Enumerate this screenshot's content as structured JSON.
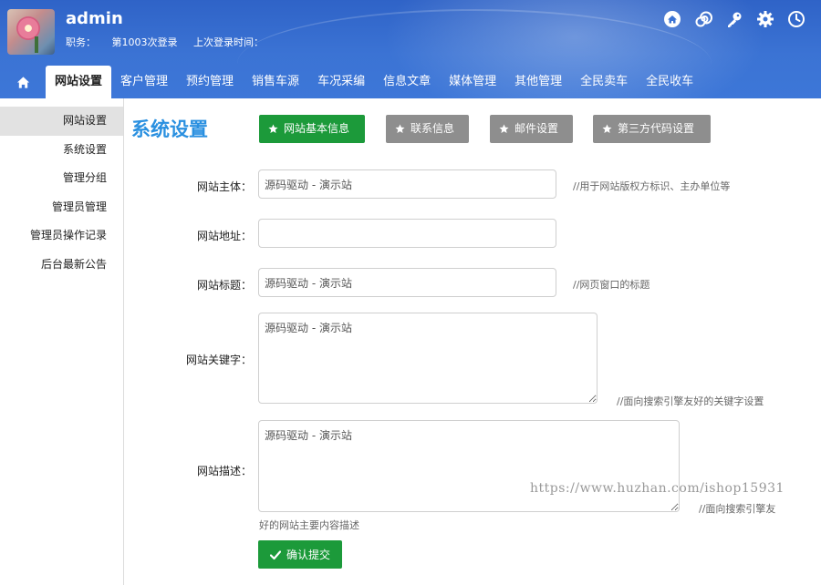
{
  "user": {
    "name": "admin",
    "role_label": "职务：",
    "login_count": "第1003次登录",
    "last_login_label": "上次登录时间："
  },
  "header_icons": [
    "home-icon",
    "spiral-icon",
    "key-icon",
    "gear-icon",
    "clock-icon"
  ],
  "nav": {
    "items": [
      "网站设置",
      "客户管理",
      "预约管理",
      "销售车源",
      "车况采编",
      "信息文章",
      "媒体管理",
      "其他管理",
      "全民卖车",
      "全民收车"
    ],
    "active": "网站设置"
  },
  "sidebar": {
    "items": [
      "网站设置",
      "系统设置",
      "管理分组",
      "管理员管理",
      "管理员操作记录",
      "后台最新公告"
    ],
    "active": "网站设置"
  },
  "page": {
    "title": "系统设置",
    "tabs": [
      "网站基本信息",
      "联系信息",
      "邮件设置",
      "第三方代码设置"
    ],
    "active_tab": "网站基本信息"
  },
  "form": {
    "site_owner": {
      "label": "网站主体：",
      "value": "源码驱动 - 演示站",
      "hint": "//用于网站版权方标识、主办单位等"
    },
    "site_url": {
      "label": "网站地址：",
      "value": ""
    },
    "site_title": {
      "label": "网站标题：",
      "value": "源码驱动 - 演示站",
      "hint": "//网页窗口的标题"
    },
    "keywords": {
      "label": "网站关键字：",
      "value": "源码驱动 - 演示站",
      "hint": "//面向搜索引擎友好的关键字设置"
    },
    "description": {
      "label": "网站描述：",
      "value": "源码驱动 - 演示站",
      "hint_a": "//面向搜索引擎友",
      "hint_b": "好的网站主要内容描述"
    },
    "submit_label": "确认提交"
  },
  "watermark": "https://www.huzhan.com/ishop15931",
  "colors": {
    "header_blue": "#3b73d4",
    "title_blue": "#2a90e0",
    "button_green": "#1c9a3a",
    "button_grey": "#8e8e8e"
  }
}
